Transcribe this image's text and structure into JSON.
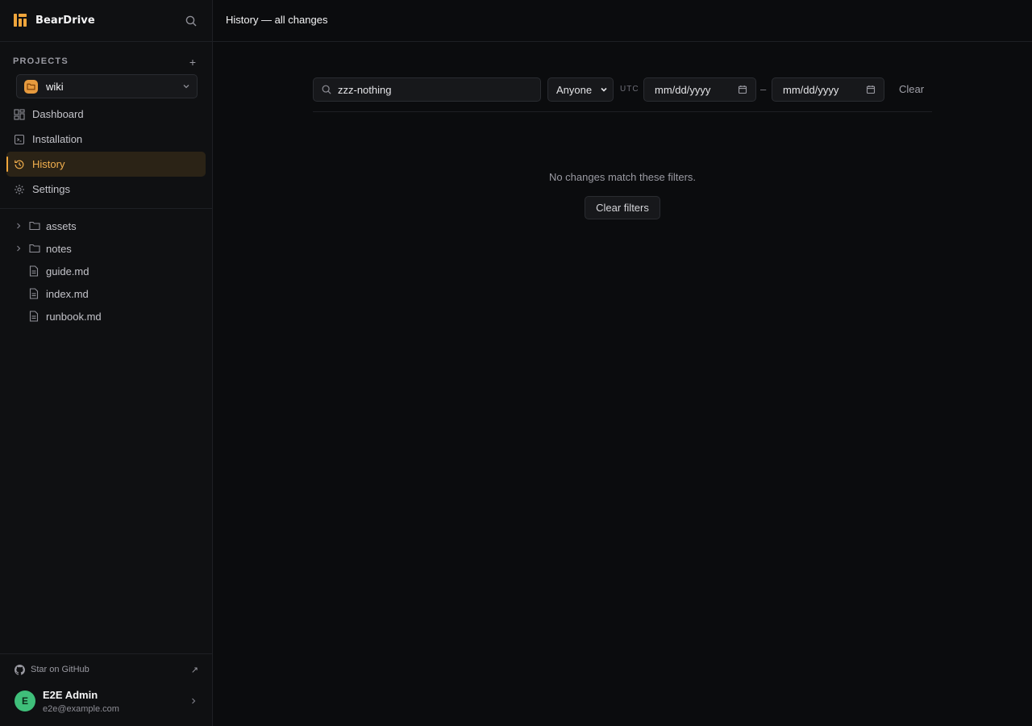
{
  "app": {
    "name": "BearDrive",
    "colors": {
      "accent": "#f0a63c",
      "active_bg": "#2b2316",
      "avatar": "#3fbf7a",
      "project": "#e69a3e"
    }
  },
  "sidebar": {
    "projects_label": "PROJECTS",
    "add_label": "+",
    "current_project": "wiki",
    "nav": [
      {
        "label": "Dashboard",
        "icon": "dashboard-icon"
      },
      {
        "label": "Installation",
        "icon": "installation-icon"
      },
      {
        "label": "History",
        "icon": "history-icon",
        "active": true
      },
      {
        "label": "Settings",
        "icon": "gear-icon"
      }
    ],
    "tree": [
      {
        "label": "assets",
        "type": "folder"
      },
      {
        "label": "notes",
        "type": "folder"
      },
      {
        "label": "guide.md",
        "type": "file"
      },
      {
        "label": "index.md",
        "type": "file"
      },
      {
        "label": "runbook.md",
        "type": "file"
      }
    ],
    "github_label": "Star on GitHub",
    "github_ext": "↗",
    "user": {
      "initial": "E",
      "name": "E2E Admin",
      "email": "e2e@example.com"
    }
  },
  "header": {
    "title": "History — all changes"
  },
  "filters": {
    "search_value": "zzz-nothing",
    "author_selected": "Anyone",
    "tz_label": "UTC",
    "date_from_placeholder": "mm/dd/yyyy",
    "date_separator": "–",
    "date_to_placeholder": "mm/dd/yyyy",
    "clear_label": "Clear"
  },
  "main": {
    "empty_message": "No changes match these filters.",
    "clear_filters_label": "Clear filters"
  }
}
